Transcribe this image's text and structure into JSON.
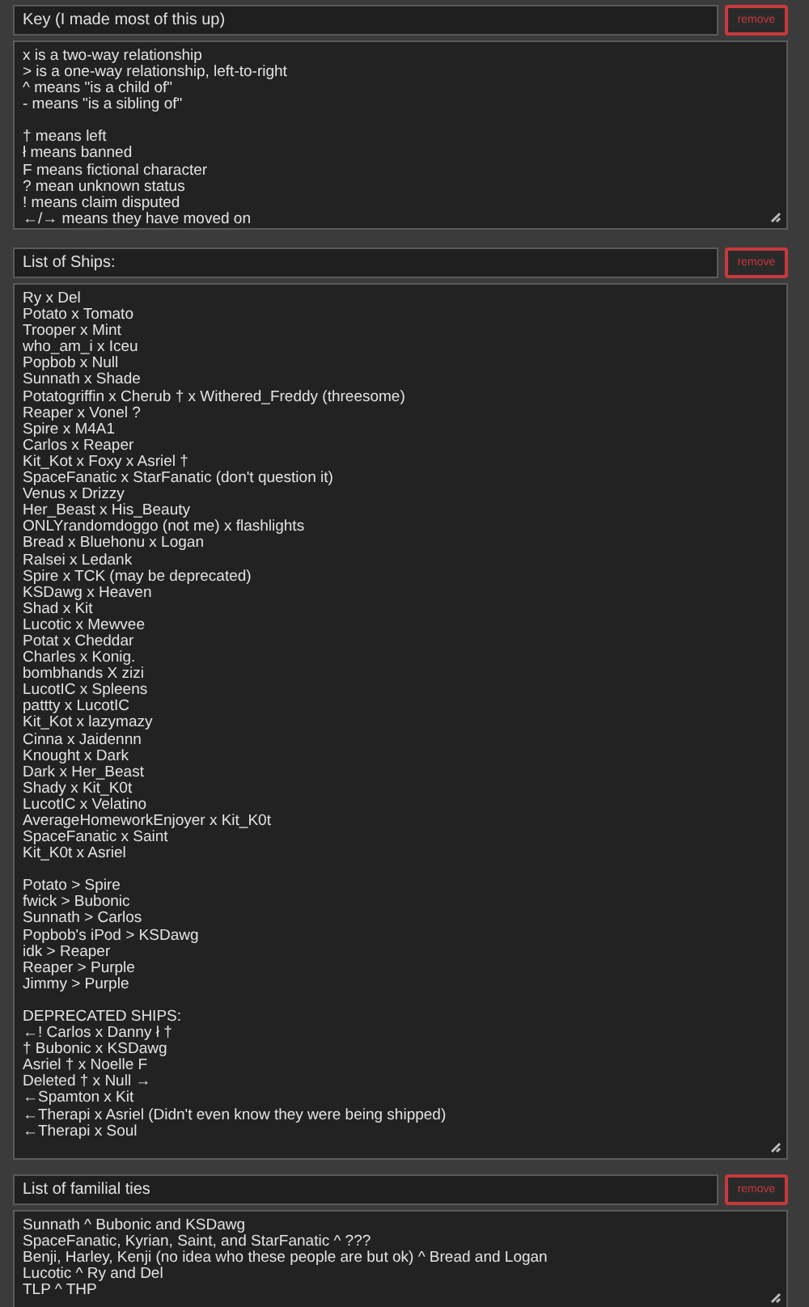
{
  "sections": [
    {
      "title": "Key (I made most of this up)",
      "remove": "remove",
      "paragraphs": [
        [
          "x is a two-way relationship",
          "> is a one-way relationship, left-to-right",
          "^ means \"is a child of\"",
          "- means \"is a sibling of\""
        ],
        [
          "† means left",
          "ł means banned",
          "F means fictional character",
          "? mean unknown status",
          "! means claim disputed",
          "←/→ means they have moved on"
        ]
      ]
    },
    {
      "title": "List of Ships:",
      "remove": "remove",
      "paragraphs": [
        [
          "Ry x Del",
          "Potato x Tomato",
          "Trooper x Mint",
          "who_am_i x Iceu",
          "Popbob x Null",
          "Sunnath x Shade",
          "Potatogriffin x Cherub † x Withered_Freddy (threesome)",
          "Reaper x Vonel ?",
          "Spire x M4A1",
          "Carlos x Reaper",
          "Kit_Kot x Foxy x Asriel †",
          "SpaceFanatic x StarFanatic (don't question it)",
          "Venus x Drizzy",
          "Her_Beast x His_Beauty",
          "ONLYrandomdoggo (not me) x flashlights",
          "Bread x Bluehonu x Logan",
          "Ralsei x Ledank",
          "Spire x TCK (may be deprecated)",
          "KSDawg x Heaven",
          "Shad x Kit",
          "Lucotic x Mewvee",
          "Potat x Cheddar",
          "Charles x Konig.",
          "bombhands X zizi",
          "LucotIC x Spleens",
          "pattty x LucotIC",
          "Kit_Kot x lazymazy",
          "Cinna x Jaidennn",
          "Knought x Dark",
          "Dark x Her_Beast",
          "Shady x Kit_K0t",
          "LucotIC x Velatino",
          "AverageHomeworkEnjoyer x Kit_K0t",
          "SpaceFanatic x Saint",
          "Kit_K0t x Asriel"
        ],
        [
          "Potato > Spire",
          "fwick > Bubonic",
          "Sunnath > Carlos",
          "Popbob's iPod > KSDawg",
          "idk > Reaper",
          "Reaper > Purple",
          "Jimmy > Purple"
        ],
        [
          "DEPRECATED SHIPS:",
          "←! Carlos x Danny ł †",
          "† Bubonic x KSDawg",
          "Asriel † x Noelle F",
          "Deleted † x Null →",
          "←Spamton x Kit",
          "←Therapi x Asriel (Didn't even know they were being shipped)",
          "←Therapi x Soul"
        ]
      ]
    },
    {
      "title": "List of familial ties",
      "remove": "remove",
      "paragraphs": [
        [
          "Sunnath ^ Bubonic and KSDawg",
          "SpaceFanatic, Kyrian, Saint, and StarFanatic ^ ???",
          "Benji, Harley, Kenji (no idea who these people are but ok) ^ Bread and Logan",
          "Lucotic ^ Ry and Del",
          "TLP ^ THP"
        ]
      ]
    }
  ]
}
